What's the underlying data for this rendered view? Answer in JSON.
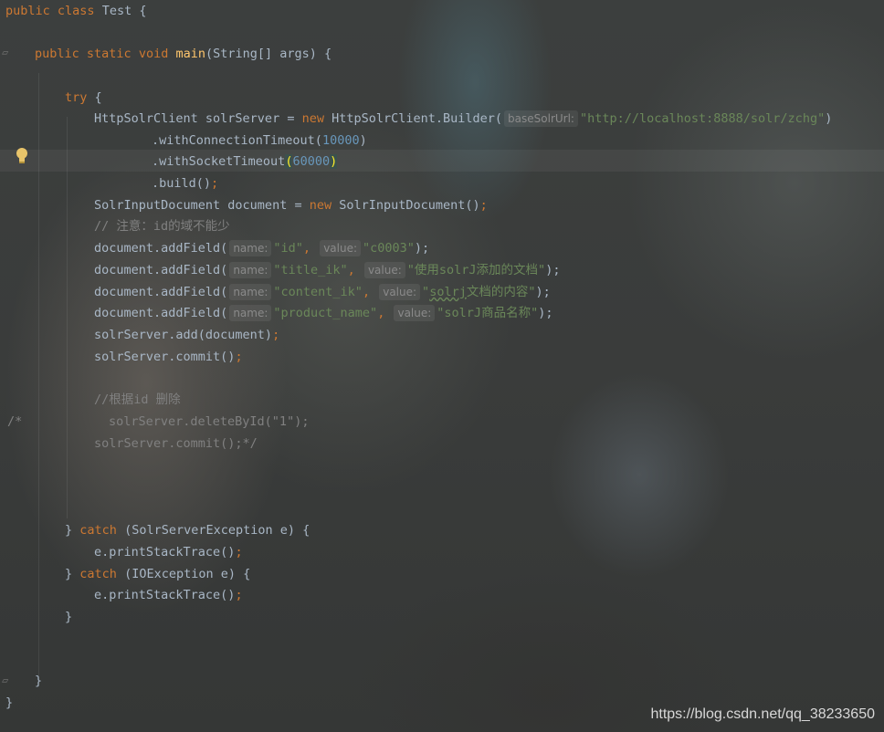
{
  "editor": {
    "lines": {
      "l1": [
        "public",
        "class",
        "Test",
        "{"
      ],
      "l3": [
        "public",
        "static",
        "void",
        "main",
        "(String[] args) {"
      ],
      "l5": [
        "try",
        "{"
      ],
      "l6": [
        "HttpSolrClient solrServer = ",
        "new",
        "HttpSolrClient.Builder(",
        "baseSolrUrl:",
        "\"http://localhost:8888/solr/zchg\"",
        ")"
      ],
      "l7": [
        ".withConnectionTimeout(",
        "10000",
        ")"
      ],
      "l8": [
        ".withSocketTimeout",
        "(",
        "60000",
        ")"
      ],
      "l9": [
        ".build()",
        ";"
      ],
      "l10": [
        "SolrInputDocument document = ",
        "new",
        "SolrInputDocument()",
        ";"
      ],
      "l11": "// 注意：id的域不能少",
      "l12": [
        "document.addField(",
        "name:",
        "\"id\"",
        ",",
        "value:",
        "\"c0003\"",
        ");"
      ],
      "l13": [
        "document.addField(",
        "name:",
        "\"title_ik\"",
        ",",
        "value:",
        "\"使用solrJ添加的文档\"",
        ");"
      ],
      "l14": [
        "document.addField(",
        "name:",
        "\"content_ik\"",
        ",",
        "value:",
        "\"",
        "solrj",
        "文档的内容\"",
        ");"
      ],
      "l15": [
        "document.addField(",
        "name:",
        "\"product_name\"",
        ",",
        "value:",
        "\"solrJ商品名称\"",
        ");"
      ],
      "l16": [
        "solrServer.add(document)",
        ";"
      ],
      "l17": [
        "solrServer.commit()",
        ";"
      ],
      "l19": "//根据id 删除",
      "l20a": "/*",
      "l20b": "solrServer.deleteById(\"1\");",
      "l21": "solrServer.commit();*/",
      "l25": [
        "}",
        "catch",
        "(SolrServerException e) {"
      ],
      "l26": [
        "e.printStackTrace()",
        ";"
      ],
      "l27": [
        "}",
        "catch",
        "(IOException e) {"
      ],
      "l28": [
        "e.printStackTrace()",
        ";"
      ],
      "l29": "}",
      "l32": "}",
      "l33": "}"
    },
    "gutter": {
      "bulb_icon": "lightbulb-icon",
      "fold_icon": "fold-marker-icon"
    }
  },
  "watermark": "https://blog.csdn.net/qq_38233650",
  "colors": {
    "keyword": "#cc7832",
    "function": "#ffc66d",
    "number": "#6897bb",
    "string": "#6a8759",
    "comment": "#808080",
    "text": "#a9b7c6"
  }
}
